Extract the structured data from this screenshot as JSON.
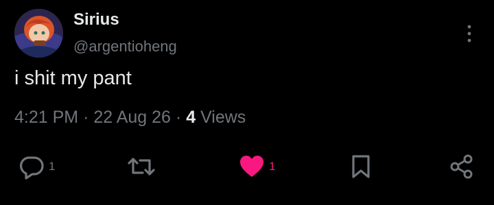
{
  "tweet": {
    "author": {
      "display_name": "Sirius",
      "handle": "@argentioheng"
    },
    "text": "i shit my pant",
    "time": "4:21 PM",
    "separator": "·",
    "date": "22 Aug 26",
    "views_count": "4",
    "views_label": "Views"
  },
  "actions": {
    "reply_count": "1",
    "retweet_count": "",
    "like_count": "1",
    "like_state": "liked"
  },
  "colors": {
    "background": "#000000",
    "primary_text": "#e7e9ea",
    "secondary_text": "#71767b",
    "like_pink": "#f91880"
  },
  "icons": {
    "more": "more-vertical-icon",
    "reply": "reply-bubble-icon",
    "retweet": "retweet-arrows-icon",
    "like": "heart-filled-icon",
    "bookmark": "bookmark-icon",
    "share": "share-nodes-icon"
  }
}
